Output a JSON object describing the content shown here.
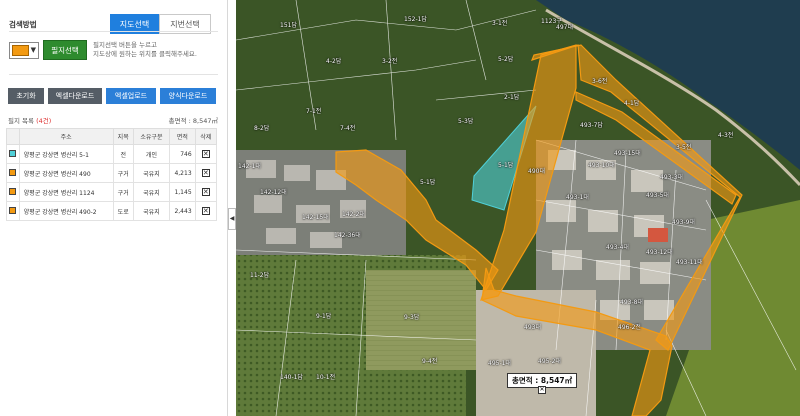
{
  "panel": {
    "search_method_label": "검색방법",
    "tab_map_select": "지도선택",
    "tab_lot_select": "지번선택",
    "parcel_select_button": "필지선택",
    "help_line1": "필지선택 버튼을 누르고",
    "help_line2": "지도상에 원하는 위치를 클릭해주세요.",
    "actions": {
      "reset": "초기화",
      "excel_download": "엑셀다운로드",
      "excel_upload": "엑셀업로드",
      "template_download": "양식다운로드"
    },
    "list_label": "필지 목록",
    "list_count": "(4건)",
    "total_area": "총면적 : 8,547㎡",
    "table_headers": [
      "",
      "주소",
      "지목",
      "소유구분",
      "면적",
      "삭제"
    ],
    "rows": [
      {
        "color": "#4fd0d8",
        "address": "양평군 강상면 병산리 5-1",
        "jimok": "전",
        "owner": "개인",
        "area": "746"
      },
      {
        "color": "#f39a12",
        "address": "양평군 강상면 병산리 490",
        "jimok": "구거",
        "owner": "국유지",
        "area": "4,213"
      },
      {
        "color": "#f39a12",
        "address": "양평군 강상면 병산리 1124",
        "jimok": "구거",
        "owner": "국유지",
        "area": "1,145"
      },
      {
        "color": "#f39a12",
        "address": "양평군 강상면 병산리 490-2",
        "jimok": "도로",
        "owner": "국유지",
        "area": "2,443"
      }
    ],
    "delete_glyph": "✕",
    "collapse_glyph": "◀",
    "dropdown_glyph": "▼"
  },
  "map": {
    "total_label": "총면적 : 8,547㎡",
    "pin_glyph": "✕",
    "parcel_labels": [
      {
        "t": "5-1답",
        "id": "l1"
      },
      {
        "t": "490대",
        "id": "l2"
      },
      {
        "t": "493-7답",
        "id": "l3"
      },
      {
        "t": "493-1대",
        "id": "l4"
      },
      {
        "t": "493-15대",
        "id": "l5"
      },
      {
        "t": "493-10대",
        "id": "l6"
      },
      {
        "t": "493-5대",
        "id": "l7"
      },
      {
        "t": "493-3대",
        "id": "l8"
      },
      {
        "t": "493-4대",
        "id": "l9"
      },
      {
        "t": "493-8대",
        "id": "l10"
      },
      {
        "t": "493-11대",
        "id": "l11"
      },
      {
        "t": "493-12대",
        "id": "l12"
      },
      {
        "t": "493-9대",
        "id": "l13"
      },
      {
        "t": "496-2전",
        "id": "l14"
      },
      {
        "t": "495-1대",
        "id": "l15"
      },
      {
        "t": "495-2대",
        "id": "l16"
      },
      {
        "t": "493대",
        "id": "l17"
      },
      {
        "t": "1123구",
        "id": "l18"
      },
      {
        "t": "4-1답",
        "id": "l19"
      },
      {
        "t": "4-3전",
        "id": "l20"
      },
      {
        "t": "3-1전",
        "id": "l21"
      },
      {
        "t": "3-6전",
        "id": "l22"
      },
      {
        "t": "3-5전",
        "id": "l23"
      },
      {
        "t": "5-1답",
        "id": "l24"
      },
      {
        "t": "5-3답",
        "id": "l25"
      },
      {
        "t": "5-2답",
        "id": "l26"
      },
      {
        "t": "7-1전",
        "id": "l27"
      },
      {
        "t": "7-4전",
        "id": "l28"
      },
      {
        "t": "142-1대",
        "id": "l29"
      },
      {
        "t": "142-12대",
        "id": "l30"
      },
      {
        "t": "142-15대",
        "id": "l31"
      },
      {
        "t": "142-2대",
        "id": "l32"
      },
      {
        "t": "142-36대",
        "id": "l33"
      },
      {
        "t": "8-2답",
        "id": "l34"
      },
      {
        "t": "9-1답",
        "id": "l35"
      },
      {
        "t": "9-3답",
        "id": "l36"
      },
      {
        "t": "9-4전",
        "id": "l37"
      },
      {
        "t": "10-1전",
        "id": "l38"
      },
      {
        "t": "140-1답",
        "id": "l39"
      },
      {
        "t": "11-2답",
        "id": "l40"
      },
      {
        "t": "151답",
        "id": "l41"
      },
      {
        "t": "152-1답",
        "id": "l42"
      },
      {
        "t": "3-2전",
        "id": "l43"
      },
      {
        "t": "4-2답",
        "id": "l44"
      },
      {
        "t": "497대",
        "id": "l45"
      },
      {
        "t": "2-1답",
        "id": "l46"
      }
    ]
  },
  "colors": {
    "primary": "#1f7fde",
    "select_green": "#2e8b2e",
    "parcel_orange": "#f39a12",
    "parcel_cyan": "#4fd0d8",
    "dark_button": "#555d66"
  }
}
